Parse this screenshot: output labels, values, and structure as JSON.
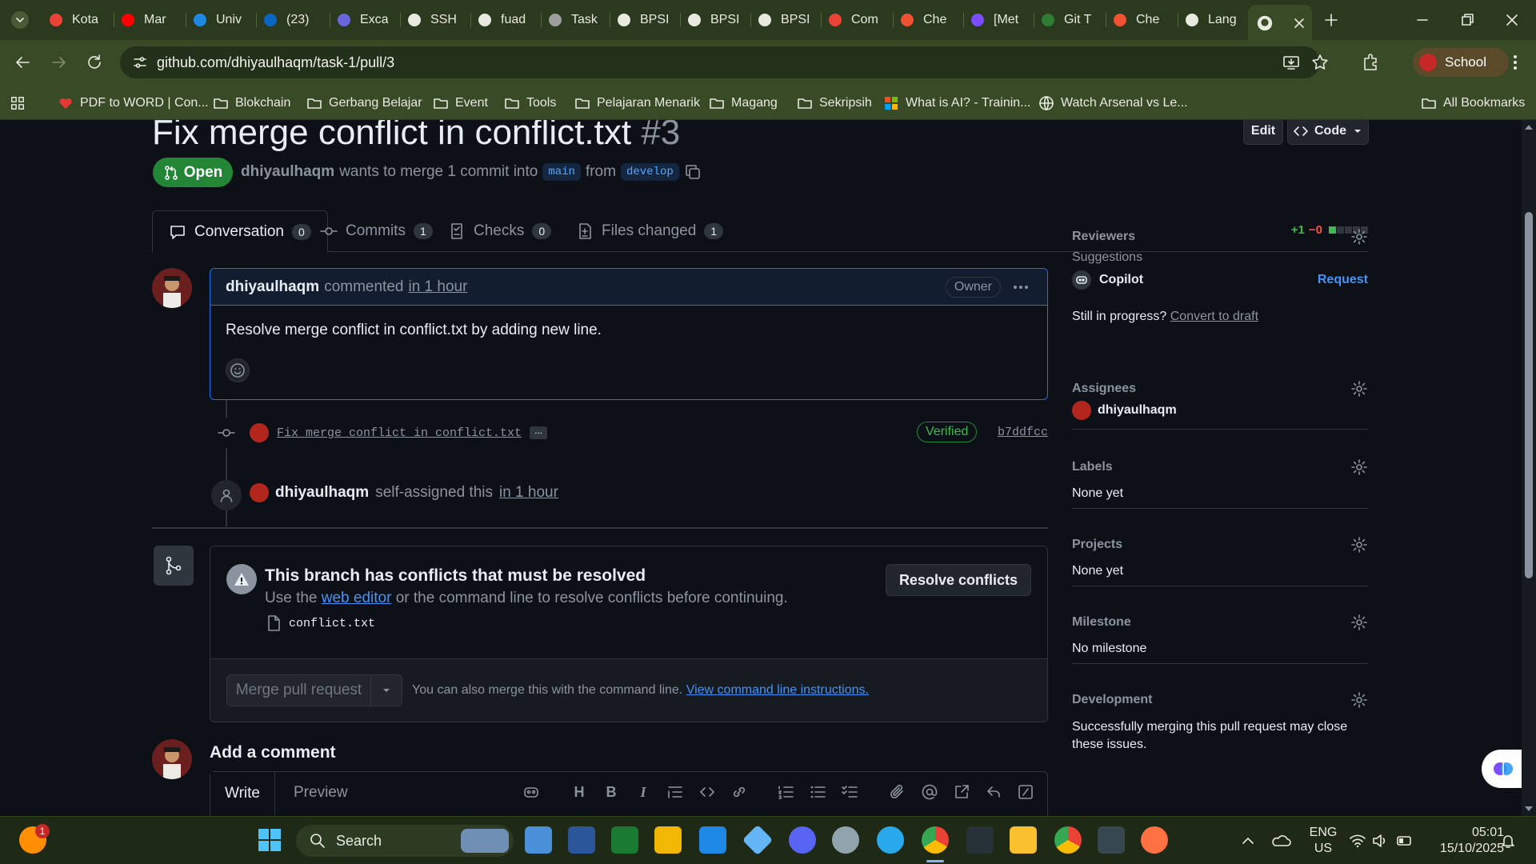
{
  "browser": {
    "tabs": [
      {
        "label": "Kota",
        "icon": "gmail-icon"
      },
      {
        "label": "Mar",
        "icon": "youtube-icon"
      },
      {
        "label": "Univ",
        "icon": "calendar-icon"
      },
      {
        "label": "(23)",
        "icon": "linkedin-icon"
      },
      {
        "label": "Exca",
        "icon": "excalidraw-icon"
      },
      {
        "label": "SSH",
        "icon": "github-icon"
      },
      {
        "label": "fuad",
        "icon": "profile-icon"
      },
      {
        "label": "Task",
        "icon": "classroom-icon"
      },
      {
        "label": "BPSI",
        "icon": "github-icon"
      },
      {
        "label": "BPSI",
        "icon": "github-icon"
      },
      {
        "label": "BPSI",
        "icon": "github-icon"
      },
      {
        "label": "Com",
        "icon": "gmail-icon"
      },
      {
        "label": "Che",
        "icon": "git-icon"
      },
      {
        "label": "[Met",
        "icon": "video-icon"
      },
      {
        "label": "Git T",
        "icon": "w-icon"
      },
      {
        "label": "Che",
        "icon": "git-icon"
      },
      {
        "label": "Lang",
        "icon": "openai-icon"
      }
    ],
    "url": "github.com/dhiyaulhaqm/task-1/pull/3",
    "profile_label": "School",
    "bookmarks": [
      {
        "label": "PDF to WORD | Con...",
        "icon": "heart-icon"
      },
      {
        "label": "Blokchain",
        "icon": "folder-icon"
      },
      {
        "label": "Gerbang Belajar",
        "icon": "folder-icon"
      },
      {
        "label": "Event",
        "icon": "folder-icon"
      },
      {
        "label": "Tools",
        "icon": "folder-icon"
      },
      {
        "label": "Pelajaran Menarik",
        "icon": "folder-icon"
      },
      {
        "label": "Magang",
        "icon": "folder-icon"
      },
      {
        "label": "Sekripsih",
        "icon": "folder-icon"
      },
      {
        "label": "What is AI? - Trainin...",
        "icon": "microsoft-icon"
      },
      {
        "label": "Watch Arsenal vs Le...",
        "icon": "globe-icon"
      }
    ],
    "all_bookmarks_label": "All Bookmarks"
  },
  "pr": {
    "title": "Fix merge conflict in conflict.txt",
    "number": "#3",
    "edit_label": "Edit",
    "code_label": "Code",
    "status": "Open",
    "author": "dhiyaulhaqm",
    "meta_text": "wants to merge 1 commit into",
    "base_branch": "main",
    "from_text": "from",
    "head_branch": "develop",
    "tabs": [
      {
        "label": "Conversation",
        "count": "0",
        "icon": "comment-icon"
      },
      {
        "label": "Commits",
        "count": "1",
        "icon": "commit-icon"
      },
      {
        "label": "Checks",
        "count": "0",
        "icon": "checklist-icon"
      },
      {
        "label": "Files changed",
        "count": "1",
        "icon": "file-diff-icon"
      }
    ],
    "diffstat_add": "+1",
    "diffstat_del": "−0",
    "diffstat_green_blocks": 1,
    "diffstat_total_blocks": 5
  },
  "comment": {
    "author": "dhiyaulhaqm",
    "action": "commented",
    "time": "in 1 hour",
    "role_badge": "Owner",
    "body": "Resolve merge conflict in conflict.txt by adding new line."
  },
  "commit": {
    "message": "Fix merge conflict in conflict.txt",
    "more": "...",
    "verified": "Verified",
    "sha": "b7ddfcc"
  },
  "assign_event": {
    "user": "dhiyaulhaqm",
    "text": "self-assigned this",
    "time": "in 1 hour"
  },
  "merge": {
    "title": "This branch has conflicts that must be resolved",
    "sub_prefix": "Use the",
    "sub_link": "web editor",
    "sub_suffix": "or the command line to resolve conflicts before continuing.",
    "file": "conflict.txt",
    "resolve_label": "Resolve conflicts",
    "merge_label": "Merge pull request",
    "hint": "You can also merge this with the command line.",
    "hint_link": "View command line instructions."
  },
  "add_comment": {
    "heading": "Add a comment",
    "write": "Write",
    "preview": "Preview",
    "heading_tool": "H",
    "bold_tool": "B",
    "italic_tool": "I"
  },
  "sidebar": {
    "reviewers": "Reviewers",
    "suggestions": "Suggestions",
    "copilot": "Copilot",
    "request": "Request",
    "still_in_progress": "Still in progress?",
    "convert_to_draft": "Convert to draft",
    "assignees": "Assignees",
    "assignee_name": "dhiyaulhaqm",
    "labels": "Labels",
    "labels_value": "None yet",
    "projects": "Projects",
    "projects_value": "None yet",
    "milestone": "Milestone",
    "milestone_value": "No milestone",
    "development": "Development",
    "development_value": "Successfully merging this pull request may close these issues."
  },
  "taskbar": {
    "search": "Search",
    "notification_count": "1",
    "lang": "ENG",
    "region": "US",
    "time": "05:01",
    "date": "15/10/2025"
  },
  "colors": {
    "accent_green": "#238636",
    "link_blue": "#4493f8",
    "browser_frame": "#394a27",
    "page_bg": "#0d1117"
  }
}
